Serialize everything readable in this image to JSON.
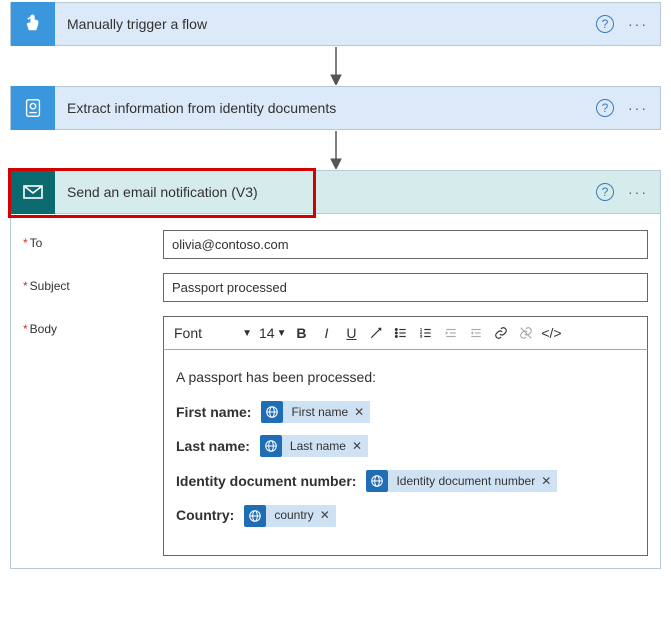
{
  "steps": {
    "trigger": {
      "title": "Manually trigger a flow"
    },
    "extract": {
      "title": "Extract information from identity documents"
    },
    "email": {
      "title": "Send an email notification (V3)"
    }
  },
  "form": {
    "to_label": "To",
    "to_value": "olivia@contoso.com",
    "subject_label": "Subject",
    "subject_value": "Passport processed",
    "body_label": "Body"
  },
  "toolbar": {
    "font_label": "Font",
    "size_label": "14"
  },
  "body": {
    "intro": "A passport has been processed:",
    "rows": {
      "first": {
        "label": "First name:",
        "token": "First name"
      },
      "last": {
        "label": "Last name:",
        "token": "Last name"
      },
      "idnum": {
        "label": "Identity document number:",
        "token": "Identity document number"
      },
      "country": {
        "label": "Country:",
        "token": "country"
      }
    }
  }
}
